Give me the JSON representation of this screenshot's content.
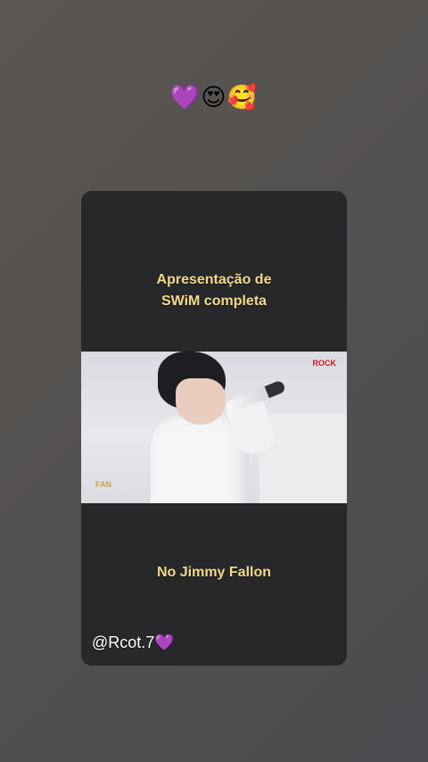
{
  "story": {
    "emojis": "💜😍🥰"
  },
  "card": {
    "caption_top": "Apresentação de\nSWiM completa",
    "caption_bottom": "No Jimmy Fallon",
    "handle_text": "@Rcot.7",
    "handle_emoji": "💜"
  },
  "video": {
    "station_logo": "ROCK",
    "corner_watermark": "FAN"
  },
  "colors": {
    "caption": "#f4d98a",
    "card_background": "#272829",
    "heart": "#9b37e8"
  }
}
